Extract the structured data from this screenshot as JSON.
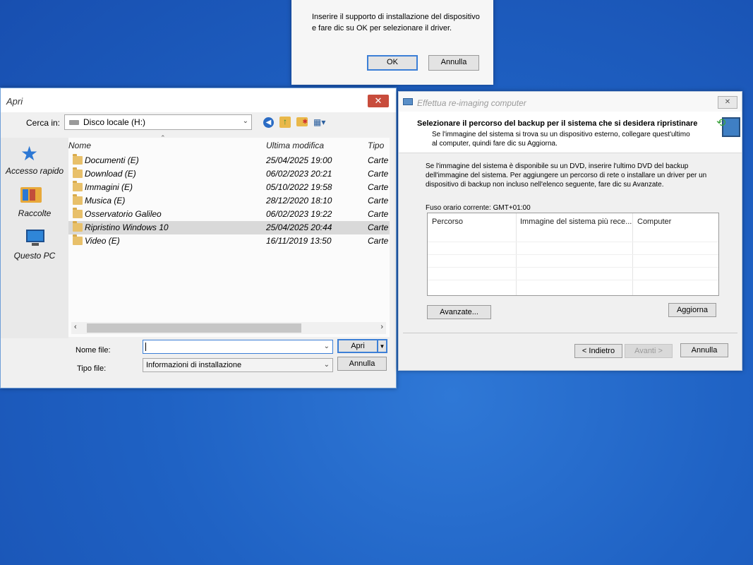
{
  "msgbox": {
    "line1": "Inserire il supporto di installazione del dispositivo",
    "line2": "e fare dic su OK per selezionare il driver.",
    "ok": "OK",
    "cancel": "Annulla"
  },
  "apri": {
    "title": "Apri",
    "close": "✕",
    "lookin_label": "Cerca in:",
    "lookin_value": "Disco locale (H:)",
    "places": [
      {
        "label": "Accesso rapido"
      },
      {
        "label": "Raccolte"
      },
      {
        "label": "Questo PC"
      }
    ],
    "columns": {
      "name": "Nome",
      "modified": "Ultima modifica",
      "type": "Tipo"
    },
    "files": [
      {
        "name": "Documenti (E)",
        "modified": "25/04/2025 19:00",
        "type": "Carte"
      },
      {
        "name": "Download (E)",
        "modified": "06/02/2023 20:21",
        "type": "Carte"
      },
      {
        "name": "Immagini (E)",
        "modified": "05/10/2022 19:58",
        "type": "Carte"
      },
      {
        "name": "Musica (E)",
        "modified": "28/12/2020 18:10",
        "type": "Carte"
      },
      {
        "name": "Osservatorio Galileo",
        "modified": "06/02/2023 19:22",
        "type": "Carte"
      },
      {
        "name": "Ripristino Windows 10",
        "modified": "25/04/2025 20:44",
        "type": "Carte"
      },
      {
        "name": "Video (E)",
        "modified": "16/11/2019 13:50",
        "type": "Carte"
      }
    ],
    "filename_label": "Nome file:",
    "filename_value": "",
    "filetype_label": "Tipo file:",
    "filetype_value": "Informazioni di installazione",
    "open": "Apri",
    "cancel": "Annulla"
  },
  "wizard": {
    "title": "Effettua re-imaging computer",
    "close": "✕",
    "heading": "Selezionare il percorso del backup per il sistema che si desidera ripristinare",
    "subtext1": "Se l'immagine del sistema si trova su un dispositivo esterno, collegare quest'ultimo",
    "subtext2": "al computer, quindi fare dic su Aggiorna.",
    "body1": "Se l'immagine del sistema è disponibile su un DVD, inserire l'ultimo DVD del backup",
    "body2": "dell'immagine del sistema. Per aggiungere un percorso di rete o installare un driver per un",
    "body3": "dispositivo di backup non incluso nell'elenco seguente, fare dic su Avanzate.",
    "timezone": "Fuso orario corrente: GMT+01:00",
    "columns": {
      "path": "Percorso",
      "image": "Immagine del sistema più rece...",
      "computer": "Computer"
    },
    "advanced": "Avanzate...",
    "refresh": "Aggiorna",
    "back": "< Indietro",
    "next": "Avanti >",
    "cancel": "Annulla"
  }
}
